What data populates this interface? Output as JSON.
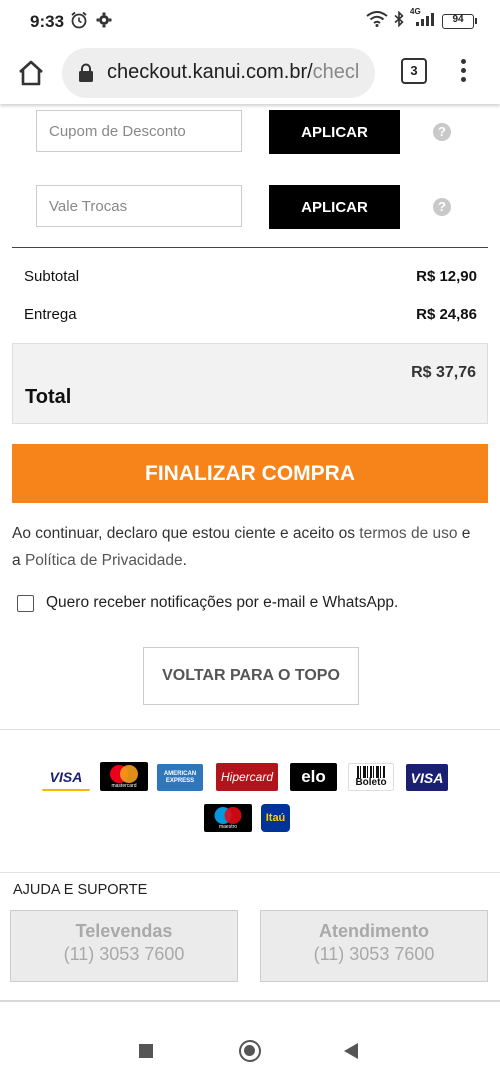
{
  "status_bar": {
    "time": "9:33",
    "battery": "94",
    "network": "4G"
  },
  "browser": {
    "url_main": "checkout.kanui.com.br/",
    "url_rest": "checl",
    "tab_count": "3"
  },
  "coupon": {
    "placeholder": "Cupom de Desconto",
    "apply_label": "APLICAR"
  },
  "voucher": {
    "placeholder": "Vale Trocas",
    "apply_label": "APLICAR"
  },
  "summary": {
    "subtotal_label": "Subtotal",
    "subtotal_value": "R$ 12,90",
    "delivery_label": "Entrega",
    "delivery_value": "R$ 24,86",
    "total_label": "Total",
    "total_value": "R$ 37,76"
  },
  "checkout_button": "FINALIZAR COMPRA",
  "terms": {
    "prefix": "Ao continuar, declaro que estou ciente e aceito os ",
    "terms_link": "termos de uso",
    "middle": " e a ",
    "privacy_link": "Política de Privacidade",
    "suffix": "."
  },
  "notify_label": "Quero receber notificações por e-mail e WhatsApp.",
  "back_to_top": "VOLTAR PARA O TOPO",
  "payment_methods": {
    "visa": "VISA",
    "mastercard": "mastercard",
    "amex": "AMERICAN EXPRESS",
    "hipercard": "Hipercard",
    "elo": "elo",
    "boleto": "Boleto",
    "visa2": "VISA",
    "maestro": "maestro",
    "itau": "Itaú"
  },
  "support": {
    "title": "AJUDA E SUPORTE",
    "televendas_label": "Televendas",
    "televendas_phone": "(11) 3053 7600",
    "atendimento_label": "Atendimento",
    "atendimento_phone": "(11) 3053 7600"
  },
  "colors": {
    "accent": "#f7841b",
    "button_dark": "#000000"
  }
}
